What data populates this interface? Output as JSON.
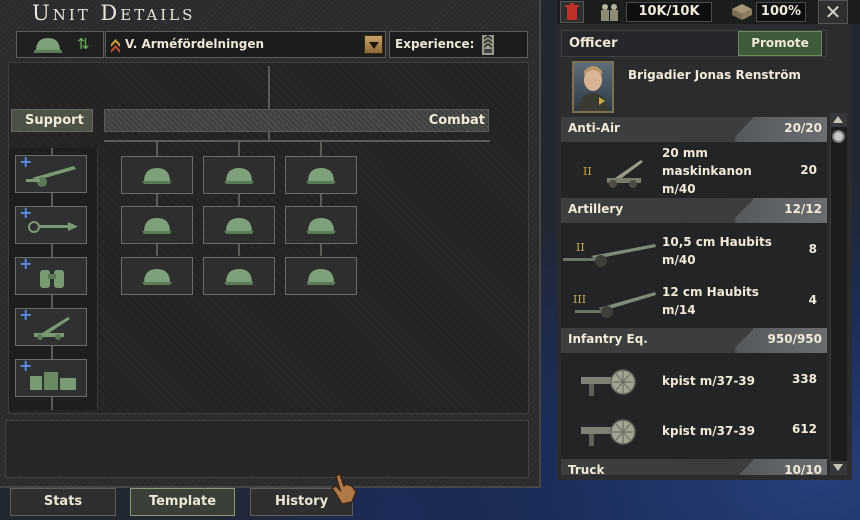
{
  "window": {
    "title": "Unit Details"
  },
  "unit": {
    "name": "V. Arméfördelningen",
    "experience_label": "Experience:"
  },
  "sections": {
    "support_label": "Support",
    "combat_label": "Combat"
  },
  "support_slots": [
    {
      "icon": "artillery-icon"
    },
    {
      "icon": "anti-tank-icon"
    },
    {
      "icon": "recon-binoculars-icon"
    },
    {
      "icon": "anti-air-icon"
    },
    {
      "icon": "logistics-icon"
    }
  ],
  "combat_slots": [
    "infantry-helmet-icon",
    "infantry-helmet-icon",
    "infantry-helmet-icon",
    "infantry-helmet-icon",
    "infantry-helmet-icon",
    "infantry-helmet-icon",
    "infantry-helmet-icon",
    "infantry-helmet-icon",
    "infantry-helmet-icon"
  ],
  "tabs": {
    "stats": "Stats",
    "template": "Template",
    "history": "History"
  },
  "topbar": {
    "manpower": "10K/10K",
    "equipment_pct": "100%"
  },
  "officer": {
    "header": "Officer",
    "promote_label": "Promote",
    "name": "Brigadier Jonas Renström"
  },
  "equipment": {
    "anti_air": {
      "name": "Anti-Air",
      "count": "20/20",
      "items": [
        {
          "tier": "II",
          "name_lines": [
            "20 mm",
            "maskinkanon",
            "m/40"
          ],
          "count": "20"
        }
      ]
    },
    "artillery": {
      "name": "Artillery",
      "count": "12/12",
      "items": [
        {
          "tier": "II",
          "name_lines": [
            "10,5 cm Haubits",
            "m/40"
          ],
          "count": "8"
        },
        {
          "tier": "III",
          "name_lines": [
            "12 cm Haubits",
            "m/14"
          ],
          "count": "4"
        }
      ]
    },
    "infantry": {
      "name": "Infantry Eq.",
      "count": "950/950",
      "items": [
        {
          "name": "kpist m/37-39",
          "count": "338"
        },
        {
          "name": "kpist m/37-39",
          "count": "612"
        }
      ]
    },
    "truck": {
      "name": "Truck",
      "count": "10/10"
    }
  },
  "colors": {
    "accent_green": "#3f5a3a",
    "panel": "#2b2c2d",
    "tier_gold": "#c9a846",
    "plus_blue": "#5e8ae8"
  }
}
